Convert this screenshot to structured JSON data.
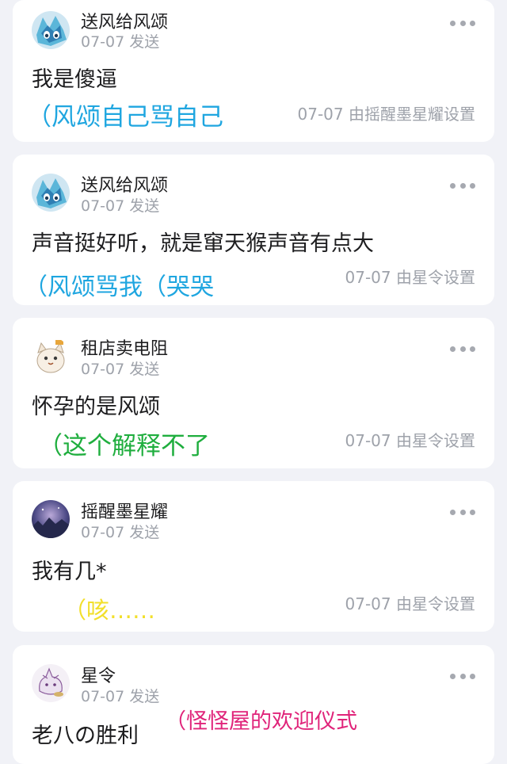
{
  "posts": [
    {
      "username": "送风给风颂",
      "meta": "07-07 发送",
      "content": "我是傻逼",
      "note": "（风颂自己骂自己",
      "note_color": "#1fa6e0",
      "setter": "07-07 由摇醒墨星耀设置"
    },
    {
      "username": "送风给风颂",
      "meta": "07-07 发送",
      "content": "声音挺好听，就是窜天猴声音有点大",
      "note": "（风颂骂我（哭哭",
      "note_color": "#1fa6e0",
      "setter": "07-07 由星令设置"
    },
    {
      "username": "租店卖电阻",
      "meta": "07-07 发送",
      "content": "怀孕的是风颂",
      "note": "（这个解释不了",
      "note_color": "#1fae3e",
      "setter": "07-07 由星令设置"
    },
    {
      "username": "摇醒墨星耀",
      "meta": "07-07 发送",
      "content": "我有几*",
      "note": "（咳……",
      "note_color": "#f2df2a",
      "setter": "07-07 由星令设置"
    },
    {
      "username": "星令",
      "meta": "07-07 发送",
      "content": "老八の胜利",
      "note": "（怪怪屋的欢迎仪式",
      "note_color": "#e0247a",
      "setter": ""
    }
  ]
}
